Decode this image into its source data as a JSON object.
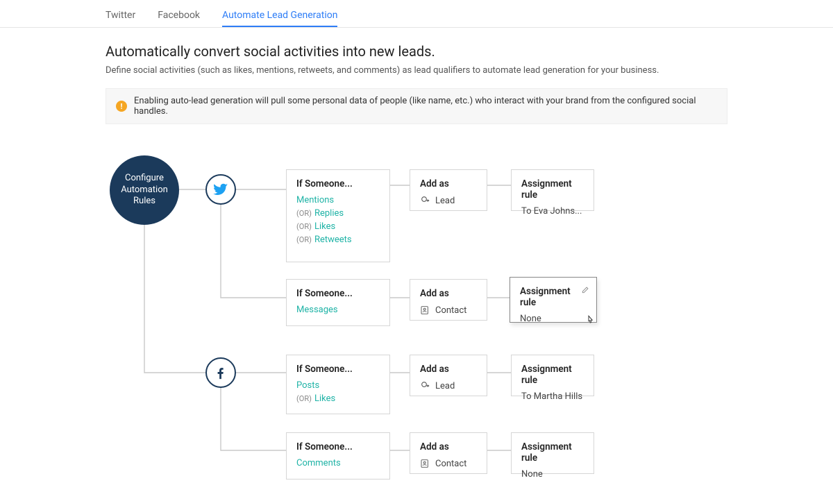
{
  "tabs": {
    "twitter": "Twitter",
    "facebook": "Facebook",
    "automate": "Automate Lead Generation"
  },
  "active_tab": "automate",
  "header": {
    "title": "Automatically convert social activities into new leads.",
    "subtitle": "Define social activities (such as likes, mentions, retweets, and comments) as lead qualifiers to automate lead generation for your business."
  },
  "alert": {
    "text": "Enabling auto-lead generation will pull some personal data of people (like name, etc.) who interact with your brand from the configured social handles."
  },
  "config_node": {
    "line1": "Configure",
    "line2": "Automation",
    "line3": "Rules"
  },
  "labels": {
    "if_someone": "If Someone...",
    "add_as": "Add as",
    "assignment_rule": "Assignment rule",
    "or": "(OR)"
  },
  "rows": [
    {
      "network": "twitter",
      "triggers": [
        "Mentions",
        "Replies",
        "Likes",
        "Retweets"
      ],
      "add_as": "Lead",
      "add_as_icon": "lead",
      "rule": "To Eva Johns..."
    },
    {
      "network": "twitter",
      "triggers": [
        "Messages"
      ],
      "add_as": "Contact",
      "add_as_icon": "contact",
      "rule": "None",
      "hovered": true
    },
    {
      "network": "facebook",
      "triggers": [
        "Posts",
        "Likes"
      ],
      "add_as": "Lead",
      "add_as_icon": "lead",
      "rule": "To Martha Hills"
    },
    {
      "network": "facebook",
      "triggers": [
        "Comments"
      ],
      "add_as": "Contact",
      "add_as_icon": "contact",
      "rule": "None"
    }
  ]
}
